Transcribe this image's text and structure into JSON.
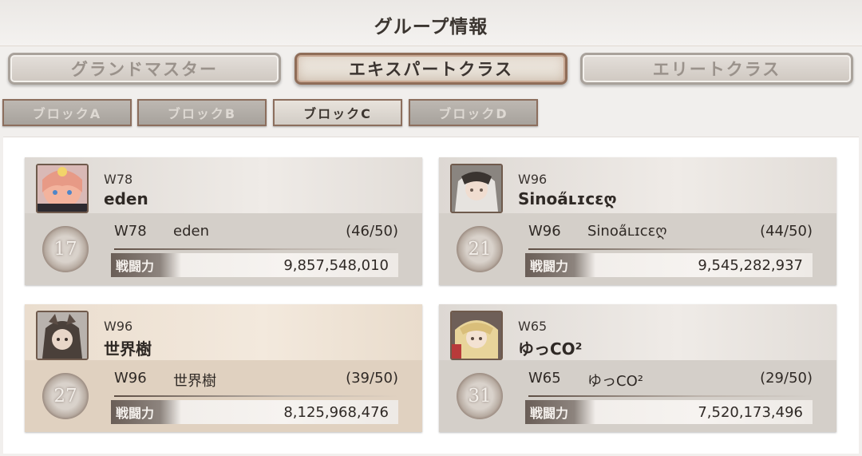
{
  "header": {
    "title": "グループ情報"
  },
  "class_tabs": [
    {
      "label": "グランドマスター",
      "active": false
    },
    {
      "label": "エキスパートクラス",
      "active": true
    },
    {
      "label": "エリートクラス",
      "active": false
    }
  ],
  "block_tabs": [
    {
      "label": "ブロックA",
      "active": false
    },
    {
      "label": "ブロックB",
      "active": false
    },
    {
      "label": "ブロックC",
      "active": true
    },
    {
      "label": "ブロックD",
      "active": false
    }
  ],
  "power_label": "戦闘力",
  "groups": [
    {
      "server": "W78",
      "name": "eden",
      "rank": "17",
      "members": "(46/50)",
      "power": "9,857,548,010"
    },
    {
      "server": "W96",
      "name": "Sinoa̋ʟɪcɛღ",
      "rank": "21",
      "members": "(44/50)",
      "power": "9,545,282,937"
    },
    {
      "server": "W96",
      "name": "世界樹",
      "rank": "27",
      "members": "(39/50)",
      "power": "8,125,968,476"
    },
    {
      "server": "W65",
      "name": "ゆっCO²",
      "rank": "31",
      "members": "(29/50)",
      "power": "7,520,173,496"
    }
  ],
  "colors": {
    "active_border": "#8f6d58",
    "highlight_card": "#e5d8c8"
  }
}
